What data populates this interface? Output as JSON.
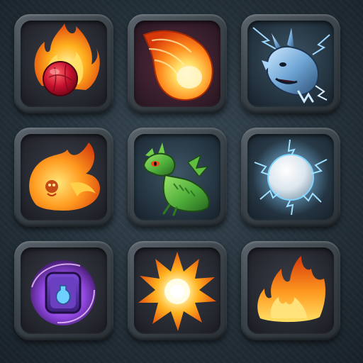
{
  "grid": {
    "tiles": [
      {
        "row": 1,
        "col": 1,
        "icon": "flaming-red-orb-icon"
      },
      {
        "row": 1,
        "col": 2,
        "icon": "fireball-icon"
      },
      {
        "row": 1,
        "col": 3,
        "icon": "ice-lightning-dragon-icon"
      },
      {
        "row": 2,
        "col": 1,
        "icon": "fire-spirit-icon"
      },
      {
        "row": 2,
        "col": 2,
        "icon": "green-dragon-icon"
      },
      {
        "row": 2,
        "col": 3,
        "icon": "lightning-orb-icon"
      },
      {
        "row": 3,
        "col": 1,
        "icon": "arcane-potion-icon"
      },
      {
        "row": 3,
        "col": 2,
        "icon": "sun-burst-icon"
      },
      {
        "row": 3,
        "col": 3,
        "icon": "flame-icon"
      }
    ]
  },
  "colors": {
    "background": "#24313a",
    "tile_frame": "#3b444b",
    "fire_orange": "#ff8a1c",
    "fire_yellow": "#ffd84a",
    "ice_blue": "#7fc7ff",
    "dragon_green": "#4fae3a",
    "arcane_purple": "#b45cff"
  }
}
